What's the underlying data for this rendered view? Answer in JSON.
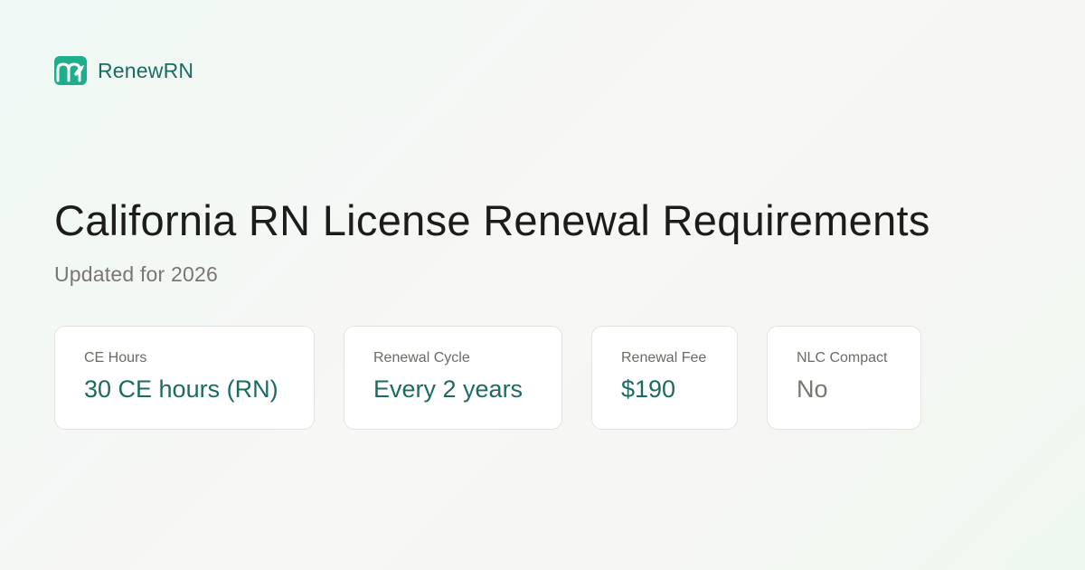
{
  "brand": {
    "name": "RenewRN",
    "logo_icon": "renewrn-logo-icon",
    "accent_color": "#1c6b63"
  },
  "header": {
    "title": "California RN License Renewal Requirements",
    "subtitle": "Updated for 2026"
  },
  "cards": [
    {
      "label": "CE Hours",
      "value": "30 CE hours (RN)"
    },
    {
      "label": "Renewal Cycle",
      "value": "Every 2 years"
    },
    {
      "label": "Renewal Fee",
      "value": "$190"
    },
    {
      "label": "NLC Compact",
      "value": "No"
    }
  ]
}
